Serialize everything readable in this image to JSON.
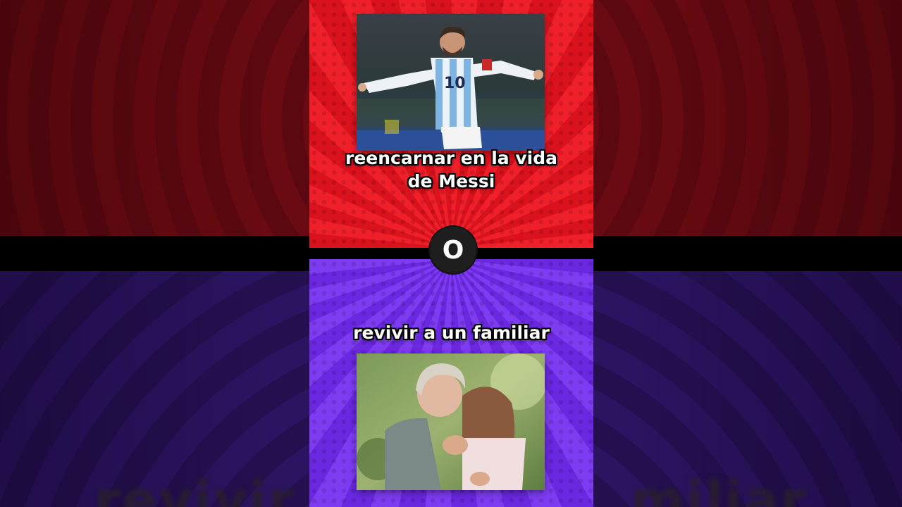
{
  "option_a": {
    "caption_line1": "reencarnar en la vida",
    "caption_line2": "de Messi",
    "image_icon": "soccer-player-photo"
  },
  "divider": {
    "label": "O"
  },
  "option_b": {
    "caption": "revivir a un familiar",
    "image_icon": "family-hug-photo"
  },
  "background_caption": {
    "left": "revivir",
    "right": "miliar"
  },
  "colors": {
    "top_panel": "#e9141f",
    "bottom_panel": "#7433ea",
    "divider": "#1e1e1e"
  }
}
